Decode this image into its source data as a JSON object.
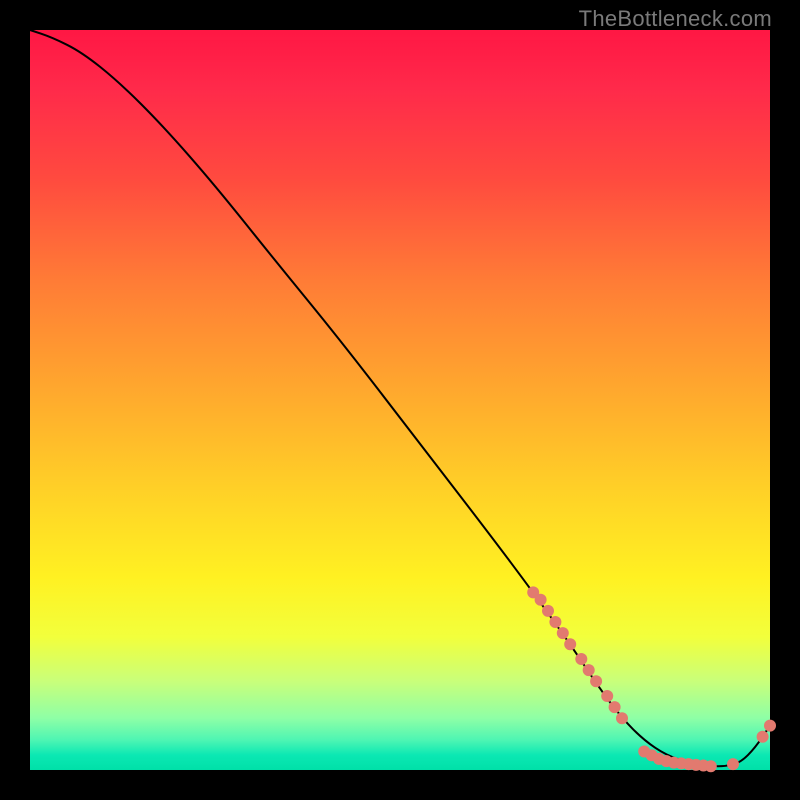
{
  "watermark": "TheBottleneck.com",
  "gradient_colors": {
    "top": "#ff1744",
    "mid_upper": "#ff7c36",
    "mid": "#ffd027",
    "mid_lower": "#fff122",
    "bottom": "#00e0a8"
  },
  "chart_data": {
    "type": "line",
    "title": "",
    "xlabel": "",
    "ylabel": "",
    "xlim": [
      0,
      100
    ],
    "ylim": [
      0,
      100
    ],
    "grid": false,
    "legend": null,
    "curve": {
      "description": "Bottleneck curve descending from top-left to a valley then rising at far right",
      "x": [
        0,
        3,
        7,
        12,
        18,
        25,
        33,
        42,
        52,
        62,
        68,
        73,
        77,
        80,
        83,
        86,
        89,
        92,
        94,
        96,
        98,
        100
      ],
      "y": [
        100,
        99,
        97,
        93,
        87,
        79,
        69,
        58,
        45,
        32,
        24,
        17,
        11,
        7,
        4,
        2,
        1,
        0.5,
        0.5,
        1,
        3,
        6
      ]
    },
    "highlighted_points": {
      "description": "Salmon-colored dotted markers on lower-right portion of curve",
      "color": "#e27a6f",
      "points": [
        {
          "x": 68,
          "y": 24
        },
        {
          "x": 69,
          "y": 23
        },
        {
          "x": 70,
          "y": 21.5
        },
        {
          "x": 71,
          "y": 20
        },
        {
          "x": 72,
          "y": 18.5
        },
        {
          "x": 73,
          "y": 17
        },
        {
          "x": 74.5,
          "y": 15
        },
        {
          "x": 75.5,
          "y": 13.5
        },
        {
          "x": 76.5,
          "y": 12
        },
        {
          "x": 78,
          "y": 10
        },
        {
          "x": 79,
          "y": 8.5
        },
        {
          "x": 80,
          "y": 7
        },
        {
          "x": 83,
          "y": 2.5
        },
        {
          "x": 84,
          "y": 2
        },
        {
          "x": 85,
          "y": 1.5
        },
        {
          "x": 86,
          "y": 1.2
        },
        {
          "x": 87,
          "y": 1
        },
        {
          "x": 88,
          "y": 0.9
        },
        {
          "x": 89,
          "y": 0.8
        },
        {
          "x": 90,
          "y": 0.7
        },
        {
          "x": 91,
          "y": 0.6
        },
        {
          "x": 92,
          "y": 0.5
        },
        {
          "x": 95,
          "y": 0.8
        },
        {
          "x": 99,
          "y": 4.5
        },
        {
          "x": 100,
          "y": 6
        }
      ]
    }
  }
}
